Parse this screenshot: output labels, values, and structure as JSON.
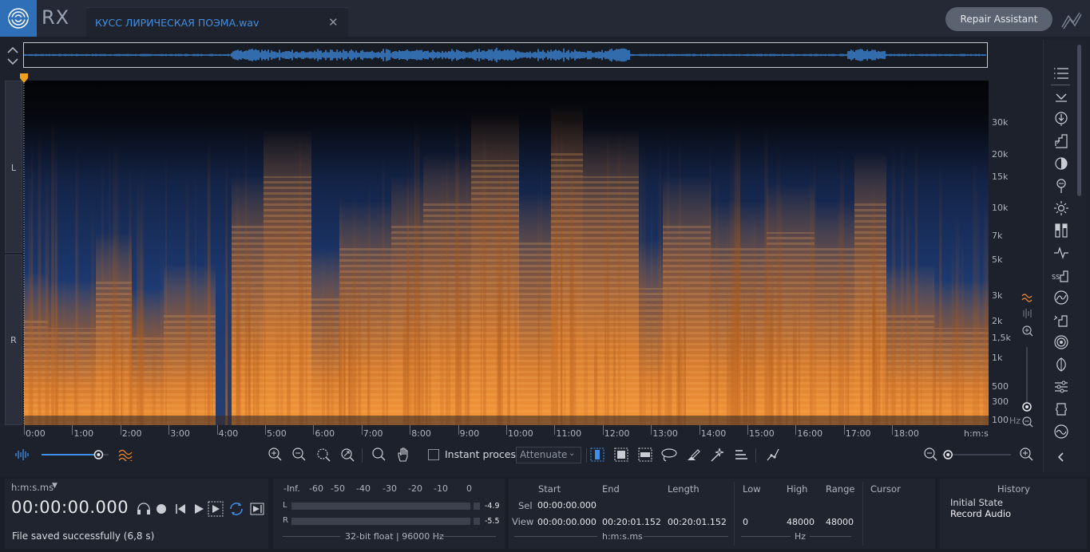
{
  "app": {
    "logo_text": "RX",
    "file_tab": "КУСС ЛИРИЧЕСКАЯ ПОЭМА.wav",
    "repair_assistant": "Repair Assistant"
  },
  "channels": {
    "left": "L",
    "right": "R"
  },
  "freq_labels": [
    "30k",
    "20k",
    "15k",
    "10k",
    "7k",
    "5k",
    "3k",
    "2k",
    "1,5k",
    "1k",
    "500",
    "300",
    "100"
  ],
  "freq_unit": "Hz",
  "time_labels": [
    "0:00",
    "1:00",
    "2:00",
    "3:00",
    "4:00",
    "5:00",
    "6:00",
    "7:00",
    "8:00",
    "9:00",
    "10:00",
    "11:00",
    "12:00",
    "13:00",
    "14:00",
    "15:00",
    "16:00",
    "17:00",
    "18:00"
  ],
  "time_unit": "h:m:s",
  "toolbar": {
    "instant_process": "Instant process",
    "instant_process_checked": false,
    "attenuate": "Attenuate",
    "waveform_zoom_level": 0.85,
    "time_zoom_level": 0.2
  },
  "transport": {
    "time_format": "h:m:s.ms",
    "timecode": "00:00:00.000",
    "status": "File saved successfully (6,8 s)"
  },
  "meters": {
    "scale": [
      "-Inf.",
      "-60",
      "-50",
      "-40",
      "-30",
      "-20",
      "-10",
      "0"
    ],
    "left_label": "L",
    "right_label": "R",
    "left_peak": "-4.9",
    "right_peak": "-5.5",
    "format": "32-bit float | 96000 Hz"
  },
  "selection": {
    "headers": [
      "Start",
      "End",
      "Length"
    ],
    "sel_label": "Sel",
    "view_label": "View",
    "sel_start": "00:00:00.000",
    "view_start": "00:00:00.000",
    "view_end": "00:20:01.152",
    "view_length": "00:20:01.152",
    "unit": "h:m:s.ms"
  },
  "frequency": {
    "headers": [
      "Low",
      "High",
      "Range"
    ],
    "low": "0",
    "high": "48000",
    "range": "48000",
    "unit": "Hz"
  },
  "cursor": {
    "label": "Cursor"
  },
  "history": {
    "title": "History",
    "items": [
      "Initial State",
      "Record Audio"
    ]
  },
  "colors": {
    "accent": "#3f8fe8",
    "spectrum_hot": "#f08a2a",
    "spectrum_cold": "#1b3566",
    "playhead": "#f1a21d"
  }
}
